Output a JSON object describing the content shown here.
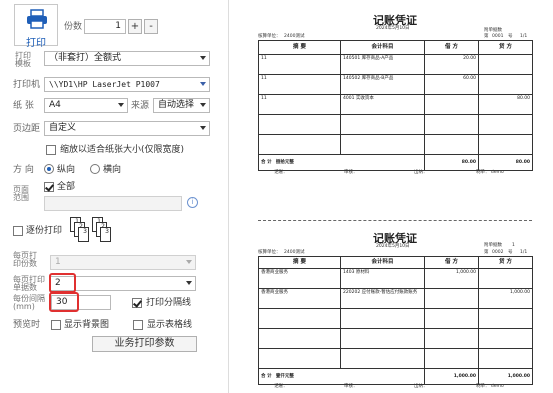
{
  "settings": {
    "print_label": "打印",
    "copies_label": "份数",
    "copies_value": "1",
    "plus_label": "+",
    "minus_label": "-",
    "template_label": "打印模板",
    "template_value": "（非套打）全额式",
    "printer_label": "打印机",
    "printer_value": "\\\\YD1\\HP LaserJet P1007",
    "paper_label": "纸 张",
    "paper_value": "A4",
    "source_label": "来源",
    "source_value": "自动选择",
    "margin_label": "页边距",
    "margin_value": "自定义",
    "fit_label": "缩放以适合纸张大小(仅限宽度)",
    "orientation_label": "方 向",
    "portrait_label": "纵向",
    "landscape_label": "横向",
    "page_range_label": "页面范围",
    "all_label": "全部",
    "page_range_value": "",
    "collate_label": "逐份打印",
    "collate_icon_labels": [
      "1",
      "2",
      "3",
      "1",
      "2",
      "3"
    ],
    "per_page_label": "每页打印份数",
    "per_page_value": "1",
    "per_page_doc_label": "每页打印单据数",
    "per_page_doc_value": "2",
    "spacing_label": "每份间隔(mm)",
    "spacing_value": "30",
    "print_divider_label": "打印分隔线",
    "preview_label": "预览时",
    "show_bg_label": "显示背景图",
    "show_grid_label": "显示表格线",
    "biz_params_button": "业务打印参数"
  },
  "voucher1": {
    "title": "记账凭证",
    "date": "2024年5月10日",
    "unit_label": "核算单位：",
    "unit_value": "2400测试",
    "attach_label": "附单据数",
    "no_label": "第",
    "no_value": "0001",
    "no_suffix": "号",
    "page": "1/1",
    "headers": [
      "摘  要",
      "会计科目",
      "借  方",
      "贷  方"
    ],
    "rows": [
      {
        "summary": "11",
        "account": "140501 库存商品-A产品",
        "debit": "20.00",
        "credit": ""
      },
      {
        "summary": "11",
        "account": "140502 库存商品-B产品",
        "debit": "60.00",
        "credit": ""
      },
      {
        "summary": "11",
        "account": "4001 实收资本",
        "debit": "",
        "credit": "80.00"
      },
      {
        "summary": "",
        "account": "",
        "debit": "",
        "credit": ""
      },
      {
        "summary": "",
        "account": "",
        "debit": "",
        "credit": ""
      }
    ],
    "total_label": "合  计",
    "total_words": "捌拾元整",
    "total_debit": "80.00",
    "total_credit": "80.00",
    "footer": [
      "记账：",
      "审核：",
      "出纳：",
      "制单：  demo"
    ]
  },
  "voucher2": {
    "title": "记账凭证",
    "date": "2024年5月10日",
    "unit_label": "核算单位：",
    "unit_value": "2400测试",
    "attach_label": "附单据数",
    "attach_value": "1",
    "no_label": "第",
    "no_value": "0002",
    "no_suffix": "号",
    "page": "1/1",
    "headers": [
      "摘  要",
      "会计科目",
      "借  方",
      "贷  方"
    ],
    "rows": [
      {
        "summary": "香港商业服务",
        "account": "1403 原材料",
        "debit": "1,000.00",
        "credit": ""
      },
      {
        "summary": "香港商业服务",
        "account": "220202 应付账款-暂估应付账款账务",
        "debit": "",
        "credit": "1,000.00"
      },
      {
        "summary": "",
        "account": "",
        "debit": "",
        "credit": ""
      },
      {
        "summary": "",
        "account": "",
        "debit": "",
        "credit": ""
      },
      {
        "summary": "",
        "account": "",
        "debit": "",
        "credit": ""
      }
    ],
    "total_label": "合  计",
    "total_words": "壹仟元整",
    "total_debit": "1,000.00",
    "total_credit": "1,000.00",
    "footer": [
      "记账：",
      "审核：",
      "出纳：",
      "制单：  demo"
    ]
  },
  "colors": {
    "accent": "#1f5fb8",
    "highlight": "#e03030"
  }
}
